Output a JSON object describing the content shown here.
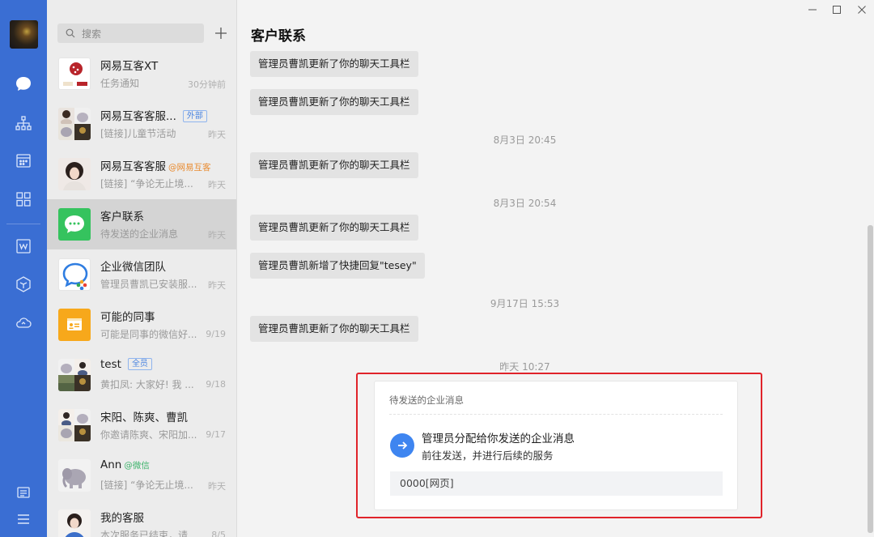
{
  "sidebar": {
    "icons": [
      "avatar",
      "chat-icon",
      "org-icon",
      "calendar-icon",
      "apps-icon",
      "doc-icon",
      "cube-icon",
      "cloud-icon",
      "notes-icon",
      "menu-icon"
    ]
  },
  "search": {
    "placeholder": "搜索"
  },
  "conversations": [
    {
      "name": "网易互客XT",
      "preview": "任务通知",
      "time": "30分钟前"
    },
    {
      "name": "网易互客客服...",
      "tag": "外部",
      "preview": "[链接]儿童节活动",
      "time": "昨天"
    },
    {
      "name": "网易互客客服",
      "corp": "@网易互客",
      "preview": "[链接] “争论无止境...",
      "time": "昨天"
    },
    {
      "name": "客户联系",
      "preview": "待发送的企业消息",
      "time": "昨天"
    },
    {
      "name": "企业微信团队",
      "preview": "管理员曹凯已安装服...",
      "time": "昨天"
    },
    {
      "name": "可能的同事",
      "preview": "可能是同事的微信好...",
      "time": "9/19"
    },
    {
      "name": "test",
      "tag": "全员",
      "preview": "黄扣凤: 大家好! 我 ...",
      "time": "9/18"
    },
    {
      "name": "宋阳、陈爽、曹凯",
      "preview": "你邀请陈爽、宋阳加...",
      "time": "9/17"
    },
    {
      "name": "Ann",
      "wx": "@微信",
      "preview": "[链接] “争论无止境...",
      "time": "昨天"
    },
    {
      "name": "我的客服",
      "preview": "本次服务已结束，请...",
      "time": "8/5"
    }
  ],
  "chat": {
    "title": "客户联系",
    "messages": [
      "管理员曹凯更新了你的聊天工具栏",
      "管理员曹凯更新了你的聊天工具栏",
      "管理员曹凯更新了你的聊天工具栏",
      "管理员曹凯更新了你的聊天工具栏",
      "管理员曹凯新增了快捷回复\"tesey\"",
      "管理员曹凯更新了你的聊天工具栏"
    ],
    "timestamps": [
      "8月3日 20:45",
      "8月3日 20:54",
      "9月17日 15:53",
      "昨天 10:27"
    ],
    "card": {
      "header": "待发送的企业消息",
      "title": "管理员分配给你发送的企业消息",
      "subtitle": "前往发送，并进行后续的服务",
      "link": "0000[网页]"
    }
  },
  "colors": {
    "rail": "#3a6ed3",
    "accent": "#3e85f0",
    "highlight": "#e0232a"
  }
}
